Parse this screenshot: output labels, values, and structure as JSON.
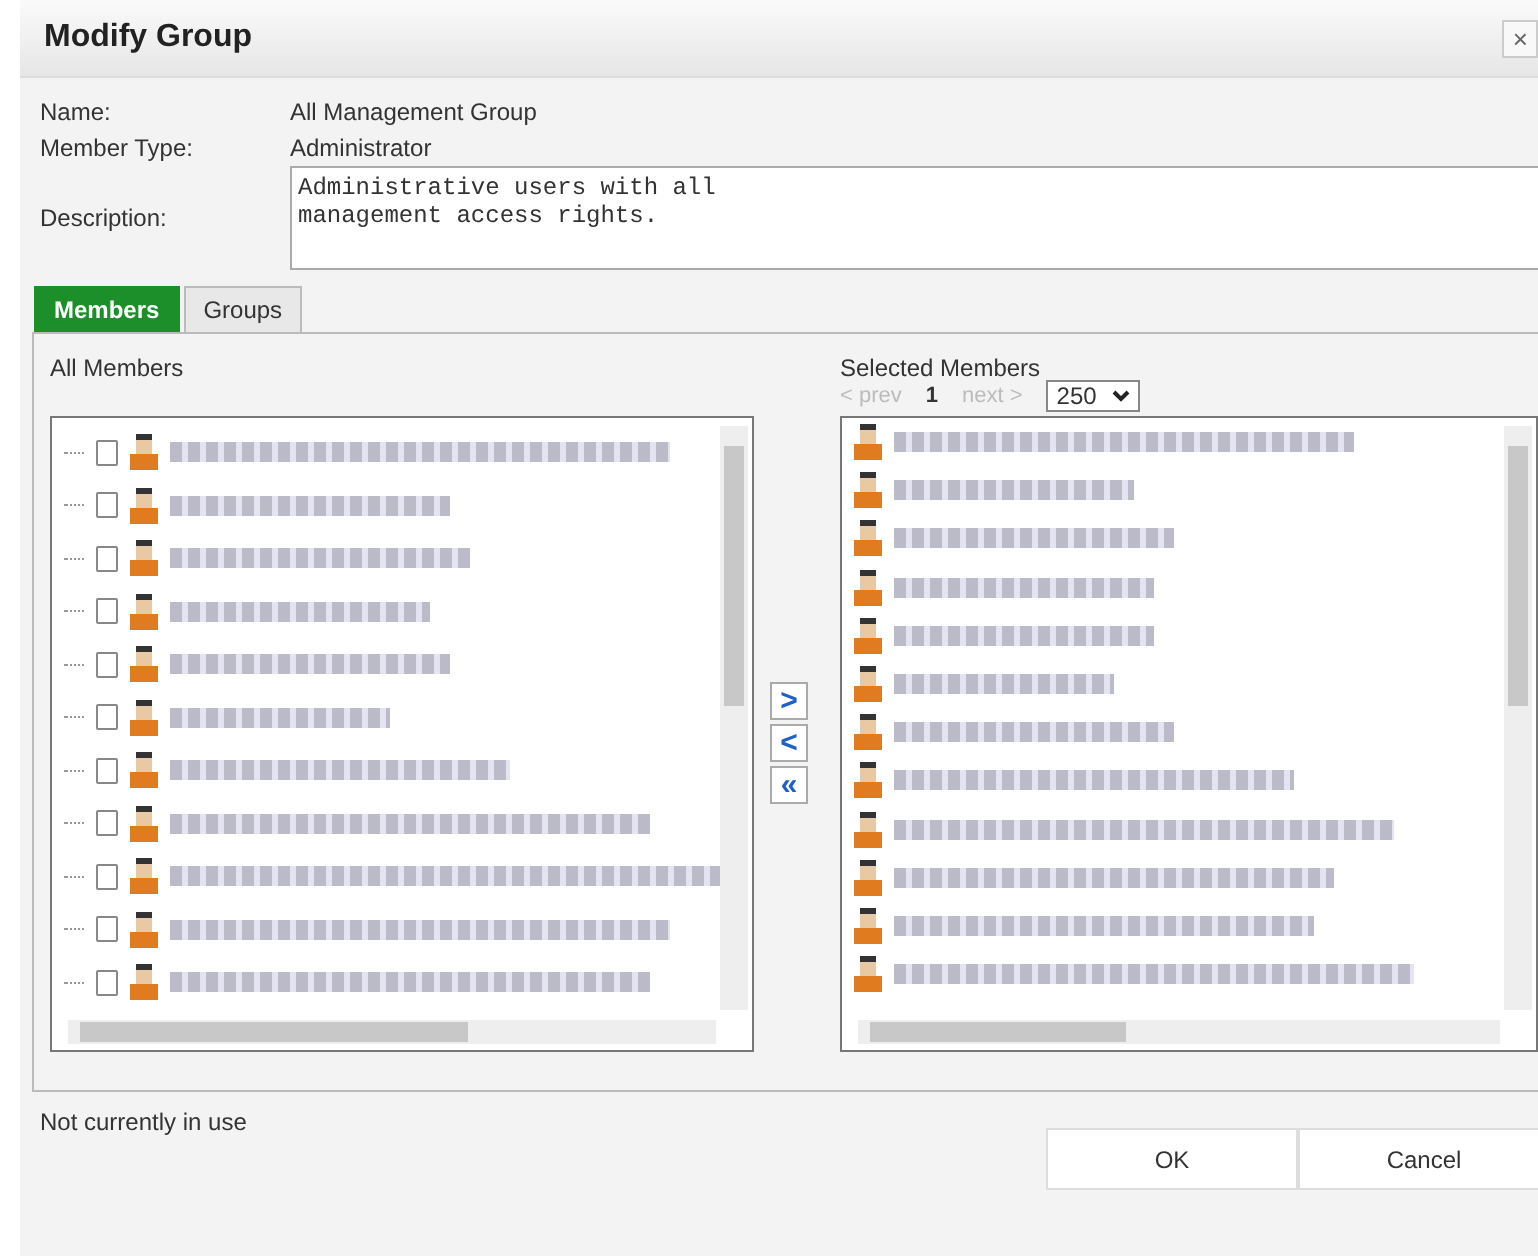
{
  "window": {
    "title": "Modify Group",
    "close": "×"
  },
  "fields": [
    {
      "label": "Name:",
      "value": "All Management Group"
    },
    {
      "label": "Member Type:",
      "value": "Administrator"
    }
  ],
  "description": {
    "label": "Description:",
    "value": "Administrative users with all\nmanagement access rights."
  },
  "tabs": [
    {
      "label": "Members",
      "selected": true
    },
    {
      "label": "Groups",
      "selected": false
    }
  ],
  "all_members": {
    "title": "All Members",
    "items": [
      {
        "checked": false
      },
      {
        "checked": false
      },
      {
        "checked": false
      },
      {
        "checked": false
      },
      {
        "checked": false
      },
      {
        "checked": false
      },
      {
        "checked": false
      },
      {
        "checked": false
      },
      {
        "checked": false
      },
      {
        "checked": false
      },
      {
        "checked": false
      }
    ]
  },
  "move_buttons": [
    ">",
    "<",
    "«"
  ],
  "selected_members": {
    "title": "Selected Members",
    "pager": {
      "prev": "< prev",
      "page": "1",
      "next": "next >",
      "prev_disabled": true,
      "next_disabled": true
    },
    "page_size": "250",
    "items": [
      {
        "kind": "user"
      },
      {
        "kind": "user"
      },
      {
        "kind": "user"
      },
      {
        "kind": "user"
      },
      {
        "kind": "user"
      },
      {
        "kind": "user"
      },
      {
        "kind": "user"
      },
      {
        "kind": "user"
      },
      {
        "kind": "user"
      },
      {
        "kind": "user"
      },
      {
        "kind": "user"
      },
      {
        "kind": "user"
      }
    ]
  },
  "status": "Not currently in use",
  "buttons": [
    "OK",
    "Cancel"
  ]
}
